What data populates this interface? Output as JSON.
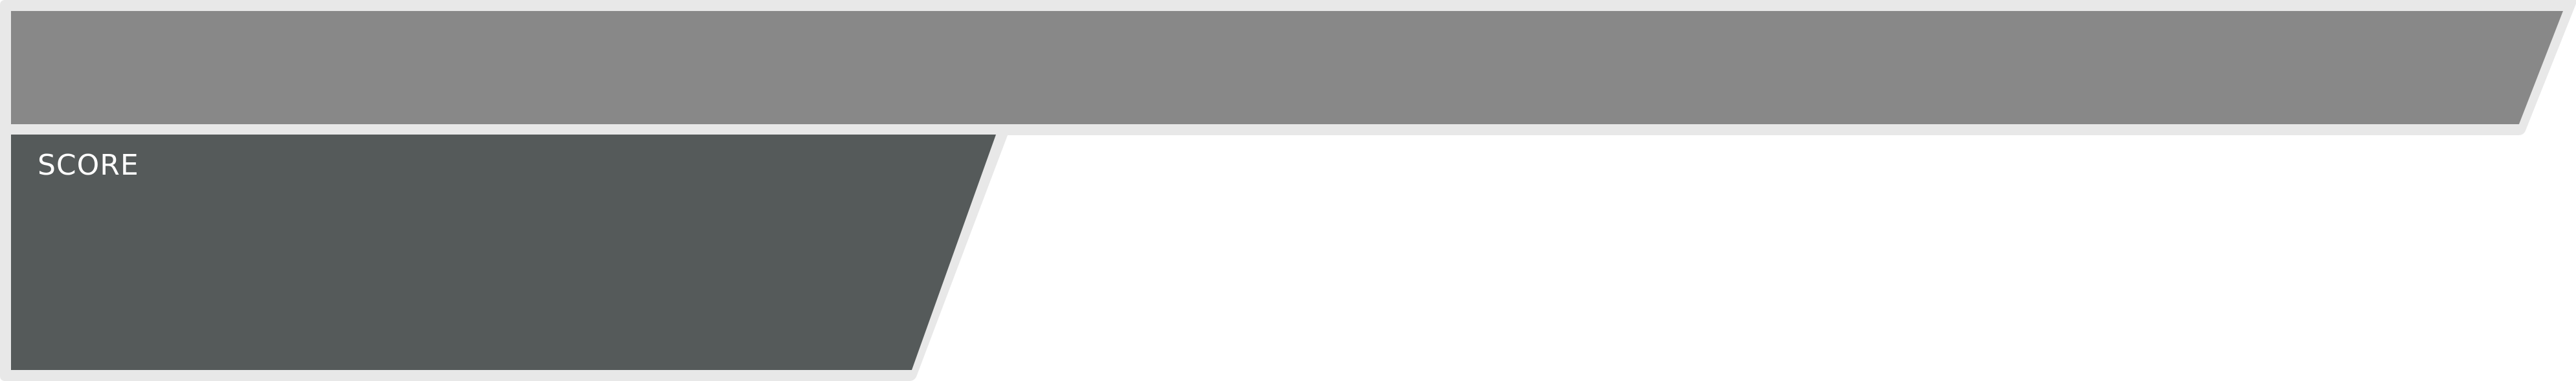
{
  "hud": {
    "score_label": "SCORE",
    "colors": {
      "frame_border": "#e8e8e8",
      "top_bar_fill": "#888888",
      "score_panel_fill": "#555a5a",
      "label_text": "#ffffff"
    }
  }
}
